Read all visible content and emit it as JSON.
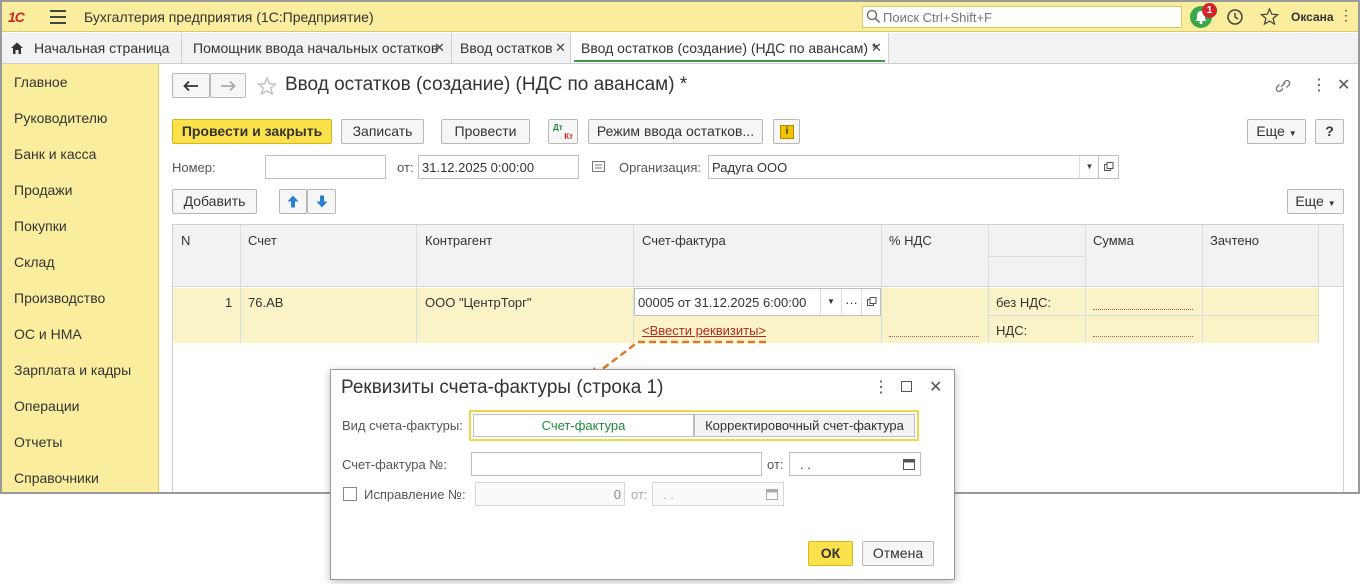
{
  "app": {
    "logo": "1С",
    "title": "Бухгалтерия предприятия  (1С:Предприятие)",
    "search_placeholder": "Поиск Ctrl+Shift+F",
    "notification_count": "1",
    "user": "Оксана"
  },
  "tabs": [
    {
      "label": "Начальная страница"
    },
    {
      "label": "Помощник ввода начальных остатков"
    },
    {
      "label": "Ввод остатков"
    },
    {
      "label": "Ввод остатков (создание) (НДС по авансам) *"
    }
  ],
  "sidebar": {
    "items": [
      {
        "label": "Главное"
      },
      {
        "label": "Руководителю"
      },
      {
        "label": "Банк и касса"
      },
      {
        "label": "Продажи"
      },
      {
        "label": "Покупки"
      },
      {
        "label": "Склад"
      },
      {
        "label": "Производство"
      },
      {
        "label": "ОС и НМА"
      },
      {
        "label": "Зарплата и кадры"
      },
      {
        "label": "Операции"
      },
      {
        "label": "Отчеты"
      },
      {
        "label": "Справочники"
      }
    ]
  },
  "doc": {
    "title": "Ввод остатков (создание) (НДС по авансам) *",
    "toolbar": {
      "post_close": "Провести и закрыть",
      "save": "Записать",
      "post": "Провести",
      "dtkt_top": "Дт",
      "dtkt_bottom": "Кт",
      "mode": "Режим ввода остатков...",
      "info": "i",
      "more": "Еще",
      "help": "?"
    },
    "number_label": "Номер:",
    "number_value": "",
    "date_label": "от:",
    "date_value": "31.12.2025  0:00:00",
    "org_label": "Организация:",
    "org_value": "Радуга ООО",
    "add_button": "Добавить",
    "table_more": "Еще"
  },
  "table": {
    "headers": {
      "n": "N",
      "account": "Счет",
      "counterparty": "Контрагент",
      "invoice": "Счет-фактура",
      "vat_rate": "% НДС",
      "sum": "Сумма",
      "offset": "Зачтено"
    },
    "row": {
      "n": "1",
      "account": "76.АВ",
      "counterparty": "ООО \"ЦентрТорг\"",
      "invoice": "00005 от 31.12.2025 6:00:00",
      "enter_details": "<Ввести реквизиты>",
      "no_vat": "без НДС:",
      "vat": "НДС:"
    }
  },
  "dialog": {
    "title": "Реквизиты счета-фактуры (строка 1)",
    "kind_label": "Вид счета-фактуры:",
    "kind_options": [
      "Счет-фактура",
      "Корректировочный счет-фактура"
    ],
    "kind_selected": "Счет-фактура",
    "invoice_no_label": "Счет-фактура №:",
    "invoice_no_value": "",
    "from_label": "от:",
    "date_value": ". .",
    "correction_label": "Исправление №:",
    "correction_value": "0",
    "correction_from_label": "от:",
    "correction_date_value": ". .",
    "ok": "ОК",
    "cancel": "Отмена"
  },
  "colors": {
    "accent_yellow": "#fbed9e",
    "primary_button": "#fbe24a",
    "link_red": "#b52a1f",
    "selected_green": "#1f8a3b",
    "arrow_orange": "#e07a20"
  }
}
